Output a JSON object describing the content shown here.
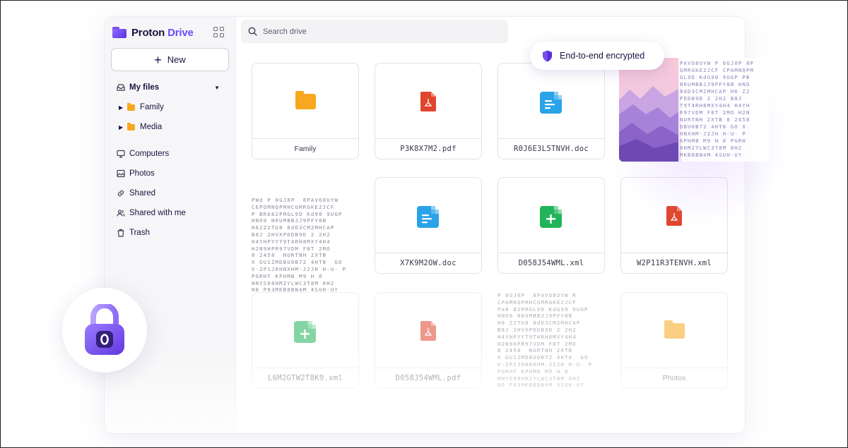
{
  "brand": {
    "name_part1": "Proton",
    "name_part2": "Drive"
  },
  "search": {
    "placeholder": "Search drive"
  },
  "sidebar": {
    "new_label": "New",
    "my_files": "My files",
    "tree": [
      {
        "label": "Family"
      },
      {
        "label": "Media"
      }
    ],
    "items": [
      {
        "label": "Computers",
        "icon": "monitor-icon"
      },
      {
        "label": "Photos",
        "icon": "image-icon"
      },
      {
        "label": "Shared",
        "icon": "link-icon"
      },
      {
        "label": "Shared with me",
        "icon": "users-icon"
      },
      {
        "label": "Trash",
        "icon": "trash-icon"
      }
    ]
  },
  "badge": {
    "label": "End-to-end encrypted"
  },
  "files": [
    {
      "name": "Family",
      "type": "folder"
    },
    {
      "name": "P3K8X7M2.pdf",
      "type": "pdf"
    },
    {
      "name": "R0J6E3L5TNVH.doc",
      "type": "doc"
    },
    {
      "name": "",
      "type": "photo"
    },
    {
      "name": "",
      "type": "encrypted"
    },
    {
      "name": "X7K9M2OW.doc",
      "type": "doc"
    },
    {
      "name": "D058J54WML.xml",
      "type": "sheet"
    },
    {
      "name": "W2P11R3TENVH.xml",
      "type": "pdf"
    },
    {
      "name": "L6M2GTW2T8K9.xml",
      "type": "sheet"
    },
    {
      "name": "D058J54WML.pdf",
      "type": "pdf"
    },
    {
      "name": "",
      "type": "encrypted"
    },
    {
      "name": "Photos",
      "type": "folder"
    }
  ],
  "colors": {
    "accent": "#6d4aff",
    "folder": "#f7a81e",
    "pdf": "#e0452e",
    "doc": "#2ba3e8",
    "sheet": "#22b45a"
  }
}
